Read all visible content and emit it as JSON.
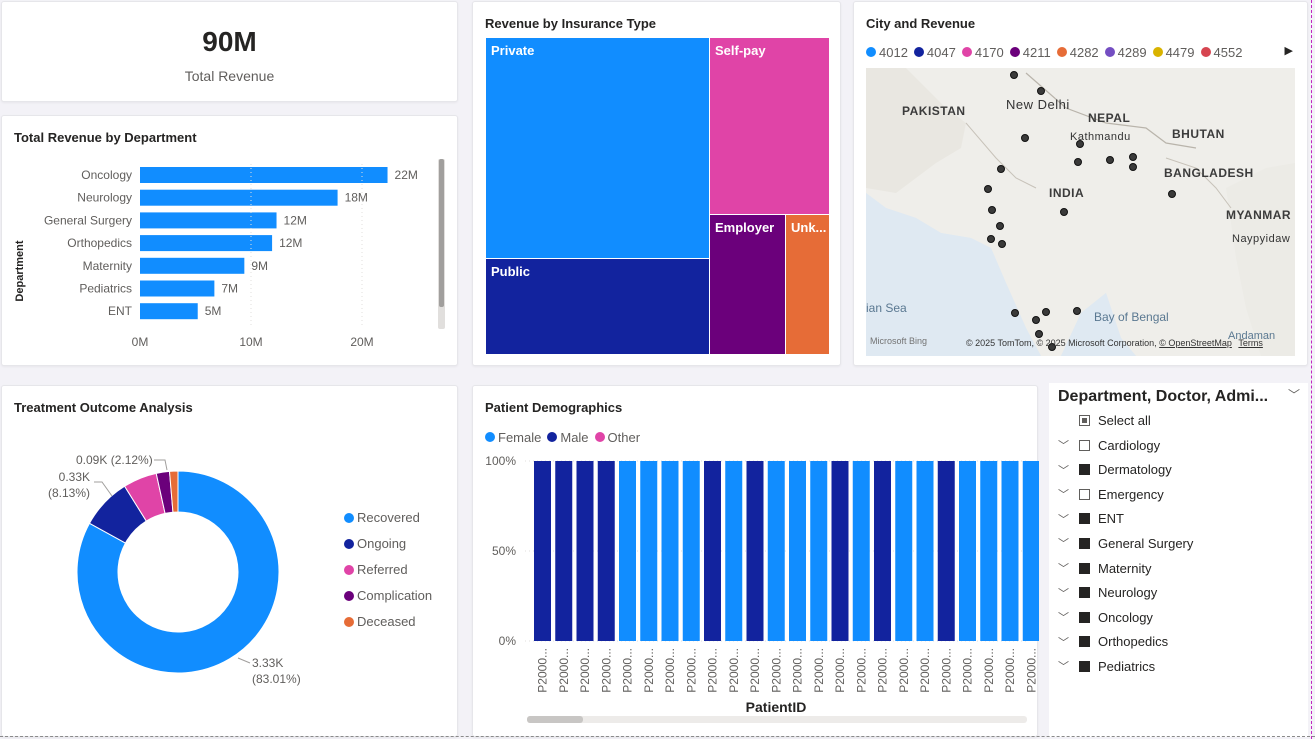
{
  "kpi": {
    "value": "90M",
    "label": "Total Revenue"
  },
  "dept_chart": {
    "title": "Total Revenue by Department",
    "ylabel": "Department",
    "chart_data": {
      "type": "bar",
      "categories": [
        "Oncology",
        "Neurology",
        "General Surgery",
        "Orthopedics",
        "Maternity",
        "Pediatrics",
        "ENT"
      ],
      "values": [
        22.3,
        17.8,
        12.3,
        11.9,
        9.4,
        6.7,
        5.2
      ],
      "data_labels": [
        "22M",
        "18M",
        "12M",
        "12M",
        "9M",
        "7M",
        "5M"
      ],
      "xticks": [
        "0M",
        "10M",
        "20M"
      ],
      "xlim": [
        0,
        25
      ],
      "color": "#118dff"
    }
  },
  "insurance_chart": {
    "title": "Revenue by Insurance Type",
    "cells": [
      {
        "label": "Private",
        "color": "#118dff"
      },
      {
        "label": "Self-pay",
        "color": "#e044a7"
      },
      {
        "label": "Public",
        "color": "#12239e"
      },
      {
        "label": "Employer",
        "color": "#6b007b"
      },
      {
        "label": "Unk...",
        "color": "#e66c37"
      }
    ]
  },
  "map_chart": {
    "title": "City and Revenue",
    "legend": [
      {
        "label": "4012",
        "color": "#118dff"
      },
      {
        "label": "4047",
        "color": "#12239e"
      },
      {
        "label": "4170",
        "color": "#e044a7"
      },
      {
        "label": "4211",
        "color": "#6b007b"
      },
      {
        "label": "4282",
        "color": "#e66c37"
      },
      {
        "label": "4289",
        "color": "#744ec2"
      },
      {
        "label": "4479",
        "color": "#d9b300"
      },
      {
        "label": "4552",
        "color": "#d64550"
      }
    ],
    "labels": {
      "pakistan": "PAKISTAN",
      "new_delhi": "New Delhi",
      "nepal": "NEPAL",
      "kathmandu": "Kathmandu",
      "bhutan": "BHUTAN",
      "bangladesh": "BANGLADESH",
      "india": "INDIA",
      "myanmar": "MYANMAR",
      "naypyidaw": "Naypyidaw",
      "arabian_sea": "ian Sea",
      "bay_of_bengal": "Bay of Bengal",
      "andaman": "Andaman"
    },
    "bing": "Microsoft Bing",
    "copyright": "© 2025 TomTom, © 2025 Microsoft Corporation,",
    "osm": "© OpenStreetMap",
    "terms": "Terms"
  },
  "outcome_chart": {
    "title": "Treatment Outcome Analysis",
    "chart_data": {
      "type": "pie",
      "categories": [
        "Recovered",
        "Ongoing",
        "Referred",
        "Complication",
        "Deceased"
      ],
      "values": [
        83.01,
        8.13,
        5.4,
        2.12,
        1.34
      ],
      "colors": [
        "#118dff",
        "#12239e",
        "#e044a7",
        "#6b007b",
        "#e66c37"
      ],
      "data_labels": [
        {
          "value": "3.33K",
          "pct": "(83.01%)"
        },
        {
          "value": "0.33K",
          "pct": "(8.13%)"
        },
        {
          "value": "0.09K (2.12%)",
          "pct": ""
        }
      ]
    }
  },
  "demographics_chart": {
    "title": "Patient Demographics",
    "legend": [
      {
        "label": "Female",
        "color": "#118dff"
      },
      {
        "label": "Male",
        "color": "#12239e"
      },
      {
        "label": "Other",
        "color": "#e044a7"
      }
    ],
    "xlabel": "PatientID",
    "yticks": [
      "100%",
      "50%",
      "0%"
    ],
    "chart_data": {
      "type": "bar",
      "stacked_percent": true,
      "categories": [
        "P2000...",
        "P2000...",
        "P2000...",
        "P2000...",
        "P2000...",
        "P2000...",
        "P2000...",
        "P2000...",
        "P2000...",
        "P2000...",
        "P2000...",
        "P2000...",
        "P2000...",
        "P2000...",
        "P2000...",
        "P2000...",
        "P2000...",
        "P2000...",
        "P2000...",
        "P2000...",
        "P2000...",
        "P2000...",
        "P2000...",
        "P2000..."
      ],
      "series_by_bar": [
        "Male",
        "Male",
        "Male",
        "Male",
        "Female",
        "Female",
        "Female",
        "Female",
        "Male",
        "Female",
        "Male",
        "Female",
        "Female",
        "Female",
        "Male",
        "Female",
        "Male",
        "Female",
        "Female",
        "Male",
        "Female",
        "Female",
        "Female",
        "Female"
      ],
      "values": [
        100,
        100,
        100,
        100,
        100,
        100,
        100,
        100,
        100,
        100,
        100,
        100,
        100,
        100,
        100,
        100,
        100,
        100,
        100,
        100,
        100,
        100,
        100,
        100
      ],
      "ylim": [
        0,
        100
      ]
    }
  },
  "slicer": {
    "title": "Department, Doctor, Admi...",
    "select_all": "Select all",
    "items": [
      {
        "label": "Cardiology",
        "checked": false
      },
      {
        "label": "Dermatology",
        "checked": true
      },
      {
        "label": "Emergency",
        "checked": false
      },
      {
        "label": "ENT",
        "checked": true
      },
      {
        "label": "General Surgery",
        "checked": true
      },
      {
        "label": "Maternity",
        "checked": true
      },
      {
        "label": "Neurology",
        "checked": true
      },
      {
        "label": "Oncology",
        "checked": true
      },
      {
        "label": "Orthopedics",
        "checked": true
      },
      {
        "label": "Pediatrics",
        "checked": true
      }
    ]
  }
}
